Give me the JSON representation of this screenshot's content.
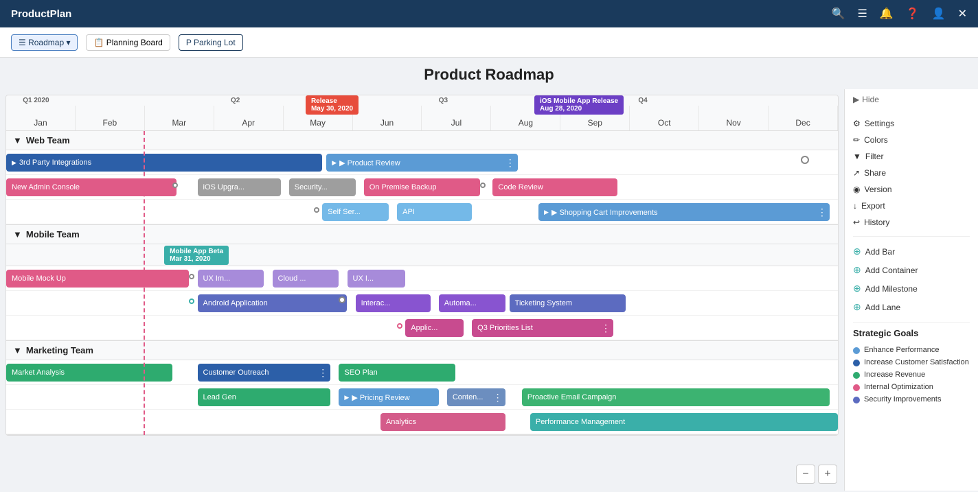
{
  "app": {
    "brand": "ProductPlan",
    "title": "Product Roadmap"
  },
  "topnav": {
    "icons": [
      "🔍",
      "☰",
      "🔔",
      "❓",
      "👤",
      "✕"
    ]
  },
  "subnav": {
    "items": [
      {
        "label": "Roadmap",
        "icon": "☰",
        "active": true
      },
      {
        "label": "Planning Board",
        "icon": "📋",
        "active": false
      },
      {
        "label": "Parking Lot",
        "icon": "P",
        "active": false
      }
    ]
  },
  "timeline": {
    "quarters": [
      {
        "label": "Q1 2020",
        "col": 0
      },
      {
        "label": "Q2",
        "col": 3
      },
      {
        "label": "Q3",
        "col": 6
      },
      {
        "label": "Q4",
        "col": 9
      }
    ],
    "months": [
      "Jan",
      "Feb",
      "Mar",
      "Apr",
      "May",
      "Jun",
      "Jul",
      "Aug",
      "Sep",
      "Oct",
      "Nov",
      "Dec"
    ]
  },
  "milestones": [
    {
      "label": "Release\nMay 30, 2020",
      "col_start": 4.3,
      "color": "#e74c3c"
    },
    {
      "label": "iOS Mobile App Release\nAug 28, 2020",
      "col_start": 7.7,
      "color": "#6c3fc5"
    }
  ],
  "swimlanes": [
    {
      "name": "Web Team",
      "rows": [
        [
          {
            "label": "3rd Party Integrations",
            "start": 0,
            "width": 4.5,
            "color": "#2c5fa8",
            "arrow_left": true
          },
          {
            "label": "Product Review",
            "start": 4.6,
            "width": 2.8,
            "color": "#5b9bd5",
            "arrow_left": true,
            "dots": true
          }
        ],
        [
          {
            "label": "New Admin Console",
            "start": 0,
            "width": 2.5,
            "color": "#e05a87"
          },
          {
            "label": "iOS Upgra...",
            "start": 2.8,
            "width": 1.3,
            "color": "#808080"
          },
          {
            "label": "Security...",
            "start": 4.2,
            "width": 1.0,
            "color": "#808080"
          },
          {
            "label": "On Premise Backup",
            "start": 5.3,
            "width": 1.8,
            "color": "#e05a87"
          },
          {
            "label": "Code Review",
            "start": 7.2,
            "width": 1.8,
            "color": "#e05a87"
          }
        ],
        [
          {
            "label": "Self Ser...",
            "start": 4.5,
            "width": 1.0,
            "color": "#74b9e8"
          },
          {
            "label": "API",
            "start": 5.6,
            "width": 1.2,
            "color": "#74b9e8"
          },
          {
            "label": "Shopping Cart Improvements",
            "start": 7.8,
            "width": 3.9,
            "color": "#5b9bd5",
            "arrow_left": true,
            "dots": true
          }
        ]
      ]
    },
    {
      "name": "Mobile Team",
      "milestone_bar": {
        "label": "Mobile App Beta\nMar 31, 2020",
        "col": 2.3,
        "color": "#3aafa9"
      },
      "rows": [
        [
          {
            "label": "Mobile Mock Up",
            "start": 0,
            "width": 2.7,
            "color": "#e05a87"
          },
          {
            "label": "UX Im...",
            "start": 2.8,
            "width": 1.0,
            "color": "#a78bda"
          },
          {
            "label": "Cloud ...",
            "start": 3.9,
            "width": 1.0,
            "color": "#a78bda"
          },
          {
            "label": "UX I...",
            "start": 5.0,
            "width": 0.9,
            "color": "#a78bda"
          }
        ],
        [
          {
            "label": "Android Application",
            "start": 2.8,
            "width": 2.2,
            "color": "#5c6bc0"
          },
          {
            "label": "Interac...",
            "start": 5.1,
            "width": 1.1,
            "color": "#7b52ab"
          },
          {
            "label": "Automa...",
            "start": 6.3,
            "width": 1.0,
            "color": "#7b52ab"
          },
          {
            "label": "Ticketing System",
            "start": 7.4,
            "width": 1.8,
            "color": "#5c6bc0"
          }
        ],
        [
          {
            "label": "Applic...",
            "start": 5.8,
            "width": 0.9,
            "color": "#e05a87"
          },
          {
            "label": "Q3 Priorities List",
            "start": 6.8,
            "width": 2.2,
            "color": "#e05a87",
            "dots": true
          }
        ]
      ]
    },
    {
      "name": "Marketing Team",
      "rows": [
        [
          {
            "label": "Market Analysis",
            "start": 0,
            "width": 2.5,
            "color": "#2eab6f"
          },
          {
            "label": "Customer Outreach",
            "start": 2.8,
            "width": 1.9,
            "color": "#2c5fa8",
            "dots": true
          },
          {
            "label": "SEO Plan",
            "start": 4.8,
            "width": 1.8,
            "color": "#2eab6f"
          }
        ],
        [
          {
            "label": "Lead Gen",
            "start": 2.8,
            "width": 2.0,
            "color": "#2eab6f"
          },
          {
            "label": "Pricing Review",
            "start": 4.9,
            "width": 1.5,
            "color": "#5b9bd5",
            "arrow_left": true
          },
          {
            "label": "Conten...",
            "start": 6.5,
            "width": 0.9,
            "color": "#5b9bd5"
          },
          {
            "label": "Proactive Email Campaign",
            "start": 7.5,
            "width": 4.0,
            "color": "#2eab6f"
          }
        ],
        [
          {
            "label": "Analytics",
            "start": 5.5,
            "width": 2.0,
            "color": "#e05a87"
          },
          {
            "label": "Performance Management",
            "start": 7.6,
            "width": 4.0,
            "color": "#3aafa9"
          }
        ]
      ]
    }
  ],
  "right_panel": {
    "hide_label": "Hide",
    "settings_label": "Settings",
    "colors_label": "Colors",
    "filter_label": "Filter",
    "share_label": "Share",
    "version_label": "Version",
    "export_label": "Export",
    "history_label": "History",
    "add_bar_label": "Add Bar",
    "add_container_label": "Add Container",
    "add_milestone_label": "Add Milestone",
    "add_lane_label": "Add Lane",
    "strategic_goals_title": "Strategic Goals",
    "goals": [
      {
        "label": "Enhance Performance",
        "color": "#5b9bd5"
      },
      {
        "label": "Increase Customer Satisfaction",
        "color": "#2c5fa8"
      },
      {
        "label": "Increase Revenue",
        "color": "#2eab6f"
      },
      {
        "label": "Internal Optimization",
        "color": "#e05a87"
      },
      {
        "label": "Security Improvements",
        "color": "#5c6bc0"
      }
    ]
  },
  "zoom": {
    "minus": "−",
    "plus": "+"
  }
}
